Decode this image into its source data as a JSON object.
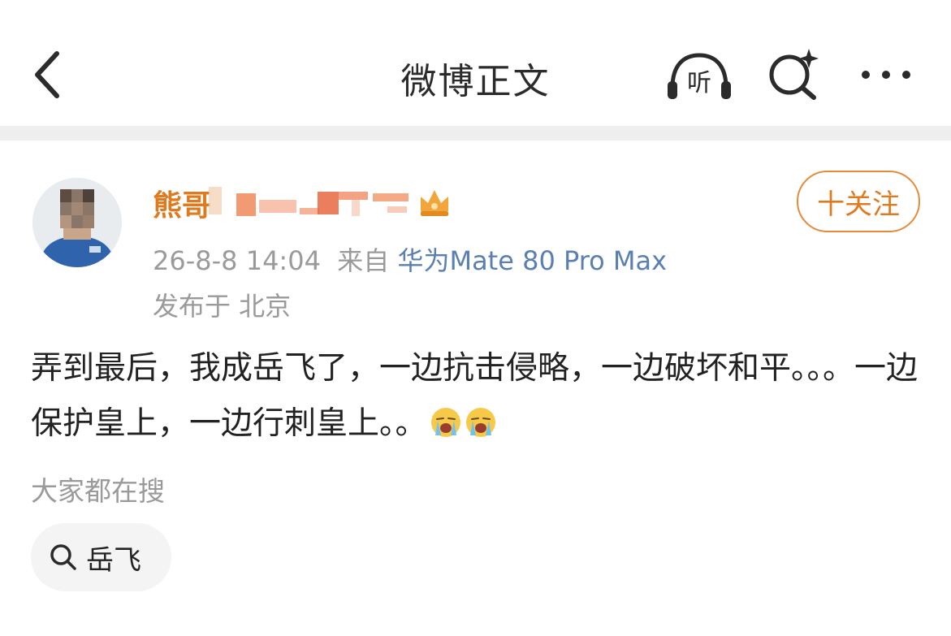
{
  "header": {
    "title": "微博正文",
    "listen_label": "听",
    "icons": [
      "back-icon",
      "listen-headphones-icon",
      "ai-search-icon",
      "more-icon"
    ]
  },
  "post": {
    "username": "熊哥",
    "follow_label": "十关注",
    "timestamp": "26-8-8 14:04",
    "source_prefix": "来自",
    "device": "华为Mate 80 Pro Max",
    "location": "发布于 北京",
    "content": "弄到最后，我成岳飞了，一边抗击侵略，一边破坏和平。。。一边保护皇上，一边行刺皇上。。"
  },
  "hot_search": {
    "title": "大家都在搜",
    "items": [
      "岳飞"
    ]
  },
  "colors": {
    "username": "#e07a1f",
    "follow_border": "#e58a3a",
    "device_link": "#5a7fb2",
    "meta_gray": "#9a9a9a",
    "divider": "#eeeeee"
  }
}
